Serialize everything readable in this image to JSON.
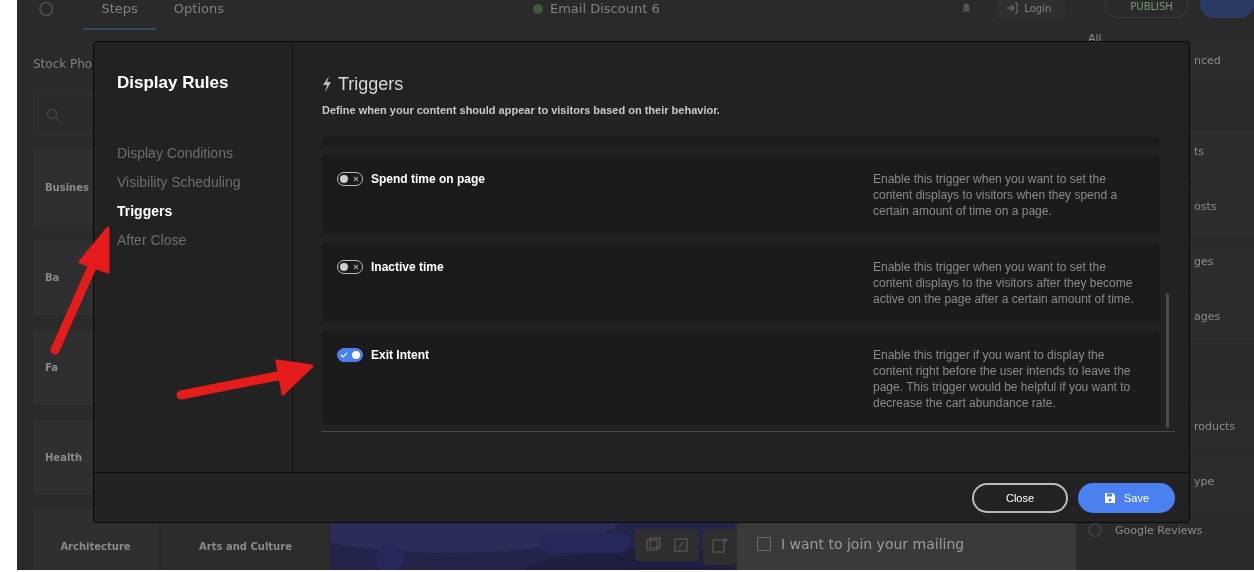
{
  "background": {
    "top_bar": {
      "tabs": [
        {
          "label": "Steps",
          "selected": true
        },
        {
          "label": "Options",
          "selected": false
        }
      ],
      "document_title": "Email Discount 6",
      "login": "Login",
      "publish": "PUBLISH"
    },
    "left_panel": {
      "heading": "Stock Pho",
      "categories": [
        "Busines",
        "Ba",
        "Fa",
        "Health",
        "Architecture",
        "Arts and Culture"
      ]
    },
    "right_panel": {
      "filter": "All",
      "items": [
        "nced",
        "ts",
        "osts",
        "ges",
        "ages",
        "roducts",
        "ype"
      ],
      "integration": "Google Reviews"
    },
    "checkbox": {
      "label": "I want to join your mailing",
      "checked": false
    }
  },
  "dialog": {
    "title": "Display Rules",
    "nav": [
      {
        "label": "Display Conditions",
        "selected": false
      },
      {
        "label": "Visibility Scheduling",
        "selected": false
      },
      {
        "label": "Triggers",
        "selected": true
      },
      {
        "label": "After Close",
        "selected": false
      }
    ],
    "section": {
      "title": "Triggers",
      "description": "Define when your content should appear to visitors based on their behavior."
    },
    "triggers": [
      {
        "name": "Spend time on page",
        "enabled": false,
        "description": "Enable this trigger when you want to set the content displays to visitors when they spend a certain amount of time on a page."
      },
      {
        "name": "Inactive time",
        "enabled": false,
        "description": "Enable this trigger when you want to set the content displays to the visitors after they become active on the page after a certain amount of time."
      },
      {
        "name": "Exit Intent",
        "enabled": true,
        "description": "Enable this trigger if you want to display the content right before the user intends to leave the page. This trigger would be helpful if you want to decrease the cart abundance rate."
      }
    ],
    "buttons": [
      {
        "label": "Close",
        "kind": "secondary"
      },
      {
        "label": "Save",
        "kind": "primary"
      }
    ]
  }
}
